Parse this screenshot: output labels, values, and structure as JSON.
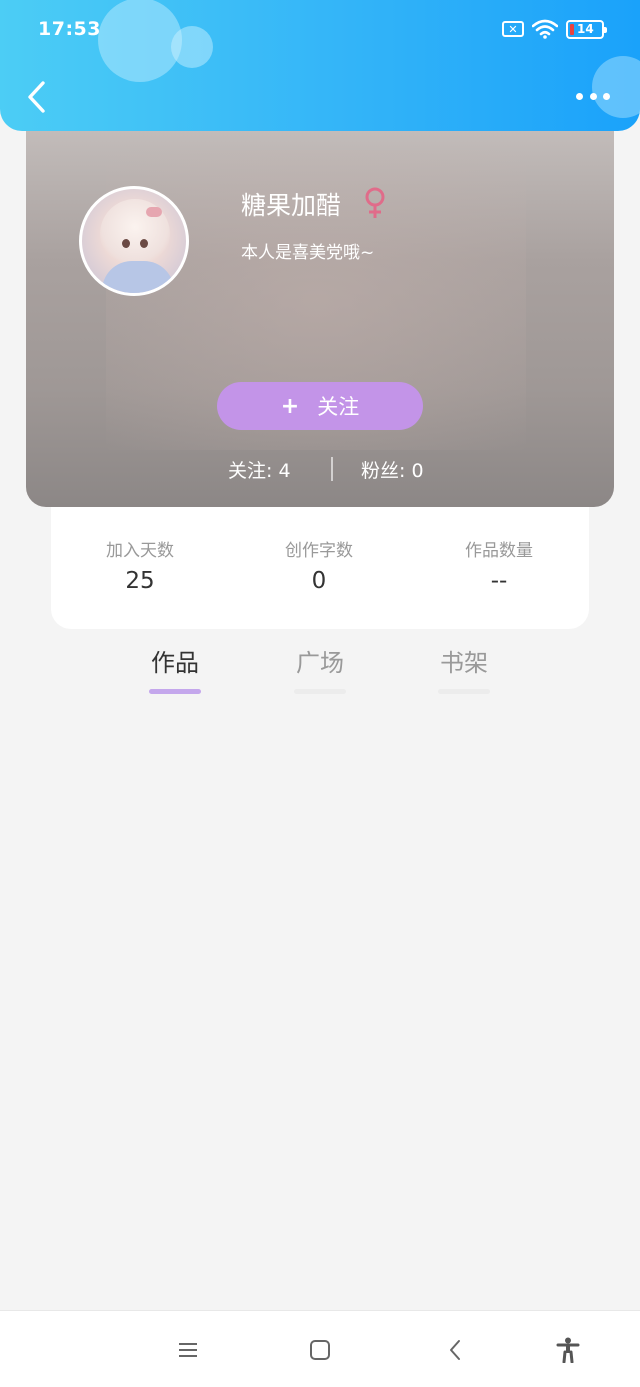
{
  "status_bar": {
    "time": "17:53",
    "sim_icon": "sim-disabled-icon",
    "wifi_icon": "wifi-icon",
    "battery_level": "14",
    "battery_color": "#e8423f"
  },
  "header": {
    "back_icon": "chevron-left-icon",
    "more_icon": "more-dots-icon",
    "gradient": [
      "#4ccdf5",
      "#1aa2fa"
    ]
  },
  "profile": {
    "name": "糖果加醋",
    "gender": "♀",
    "gender_color": "#e06c8a",
    "bio": "本人是喜美党哦~",
    "follow_plus": "+",
    "follow_label": "关注",
    "follow_color": "#c394e8",
    "following_text": "关注: 4",
    "fans_text": "粉丝: 0"
  },
  "stats": [
    {
      "label": "加入天数",
      "value": "25"
    },
    {
      "label": "创作字数",
      "value": "0"
    },
    {
      "label": "作品数量",
      "value": "--"
    }
  ],
  "tabs": [
    {
      "label": "作品",
      "active": true
    },
    {
      "label": "广场",
      "active": false
    },
    {
      "label": "书架",
      "active": false
    }
  ],
  "accent_color": "#c4a7ec",
  "nav_bar": {
    "icons": [
      "menu-icon",
      "home-icon",
      "back-icon",
      "accessibility-icon"
    ]
  }
}
